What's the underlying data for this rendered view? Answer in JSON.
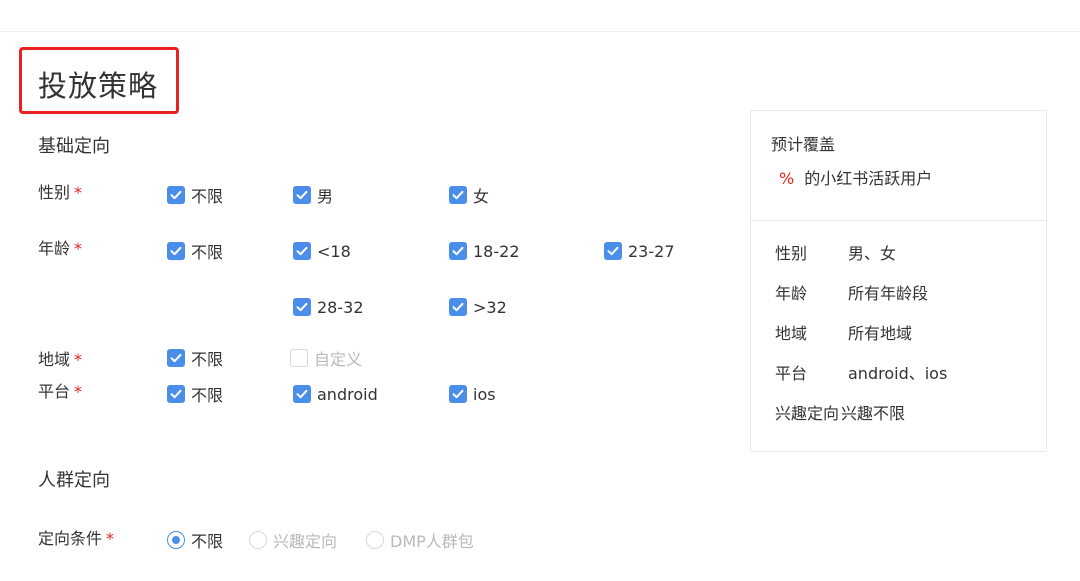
{
  "page": {
    "title": "投放策略"
  },
  "base": {
    "title": "基础定向",
    "gender": {
      "label": "性别",
      "options": [
        "不限",
        "男",
        "女"
      ]
    },
    "age": {
      "label": "年龄",
      "options": [
        "不限",
        "<18",
        "18-22",
        "23-27",
        "28-32",
        ">32"
      ]
    },
    "region": {
      "label": "地域",
      "options": [
        "不限",
        "自定义"
      ]
    },
    "platform": {
      "label": "平台",
      "options": [
        "不限",
        "android",
        "ios"
      ]
    }
  },
  "crowd": {
    "title": "人群定向",
    "condition": {
      "label": "定向条件",
      "options": [
        "不限",
        "兴趣定向",
        "DMP人群包"
      ]
    }
  },
  "required_mark": "*",
  "summary": {
    "title": "预计覆盖",
    "percent": "%",
    "suffix": "的小红书活跃用户",
    "rows": [
      {
        "key": "性别",
        "value": "男、女"
      },
      {
        "key": "年龄",
        "value": "所有年龄段"
      },
      {
        "key": "地域",
        "value": "所有地域"
      },
      {
        "key": "平台",
        "value": "android、ios"
      },
      {
        "key": "兴趣定向",
        "value": "兴趣不限"
      }
    ]
  },
  "colors": {
    "accent": "#4a8eea",
    "required": "#e62222",
    "highlight_border": "#e62222"
  },
  "icons": {
    "checked": "checkmark-icon",
    "radio": "radio-dot-icon"
  }
}
